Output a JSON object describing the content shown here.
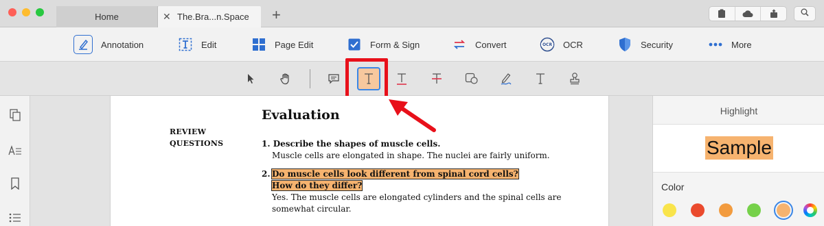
{
  "tabs": [
    {
      "label": "Home"
    },
    {
      "label": "The.Bra...n.Space"
    }
  ],
  "main_toolbar": {
    "items": [
      {
        "label": "Annotation"
      },
      {
        "label": "Edit"
      },
      {
        "label": "Page Edit"
      },
      {
        "label": "Form & Sign"
      },
      {
        "label": "Convert"
      },
      {
        "label": "OCR"
      },
      {
        "label": "Security"
      },
      {
        "label": "More"
      }
    ]
  },
  "document": {
    "title": "Evaluation",
    "section_label_1": "REVIEW",
    "section_label_2": "QUESTIONS",
    "q1_question": "1. Describe the shapes of muscle cells.",
    "q1_answer": "Muscle cells are elongated in shape. The nuclei are fairly uniform.",
    "q2_number": "2.",
    "q2_question_line1": "Do muscle cells look different from spinal cord cells?",
    "q2_question_line2": "How do they differ?",
    "q2_answer_line1": "Yes. The muscle cells are elongated cylinders and the spinal cells are",
    "q2_answer_line2": "somewhat circular."
  },
  "right_panel": {
    "title": "Highlight",
    "sample": "Sample",
    "color_label": "Color",
    "swatches": [
      "#f9e44b",
      "#ea4a2d",
      "#f29b3e",
      "#76d14a",
      "#f6b36f"
    ],
    "selected_swatch": 4
  },
  "colors": {
    "accent": "#3a86e6",
    "highlight": "#f6b36f",
    "callout": "#e8101a"
  }
}
